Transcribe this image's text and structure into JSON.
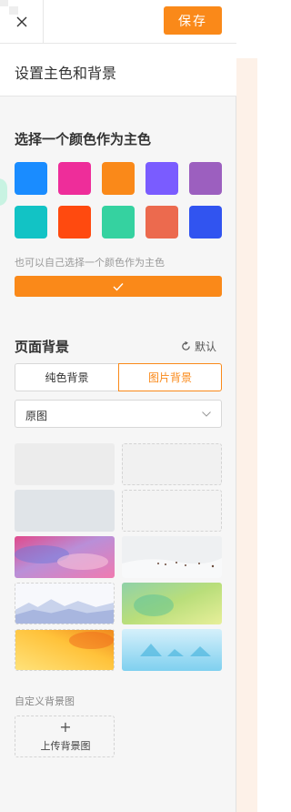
{
  "header": {
    "save_label": "保存",
    "panel_title": "设置主色和背景"
  },
  "theme": {
    "section_title": "选择一个颜色作为主色",
    "colors": [
      "#1a8cff",
      "#ee2d9a",
      "#fa8919",
      "#7a5cff",
      "#9c5fbf",
      "#12c3c5",
      "#ff4a0f",
      "#35d2a0",
      "#ec6a4e",
      "#3154f0"
    ],
    "hint": "也可以自己选择一个颜色作为主色",
    "custom_color": "#fa8919"
  },
  "background": {
    "section_title": "页面背景",
    "default_label": "默认",
    "tabs": [
      "纯色背景",
      "图片背景"
    ],
    "active_tab": "图片背景",
    "mode_select": "原图",
    "custom_label": "自定义背景图",
    "upload_label": "上传背景图",
    "upload_plus": "+"
  }
}
